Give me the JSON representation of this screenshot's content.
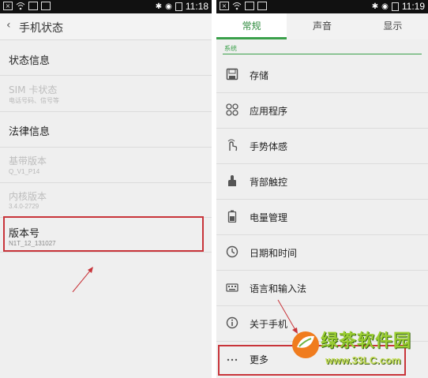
{
  "left": {
    "status_time": "11:18",
    "title": "手机状态",
    "rows": [
      {
        "title": "状态信息",
        "sub": ""
      },
      {
        "title": "SIM 卡状态",
        "sub": "电话号码、信号等"
      },
      {
        "title": "法律信息",
        "sub": ""
      },
      {
        "title": "基带版本",
        "sub": "Q_V1_P14"
      },
      {
        "title": "内核版本",
        "sub": "3.4.0-2729"
      },
      {
        "title": "版本号",
        "sub": "N1T_12_131027"
      }
    ]
  },
  "right": {
    "status_time": "11:19",
    "tabs": [
      "常规",
      "声音",
      "显示"
    ],
    "section": "系统",
    "items": [
      {
        "label": "存储",
        "icon": "storage-icon"
      },
      {
        "label": "应用程序",
        "icon": "apps-icon"
      },
      {
        "label": "手势体感",
        "icon": "gesture-icon"
      },
      {
        "label": "背部触控",
        "icon": "back-touch-icon"
      },
      {
        "label": "电量管理",
        "icon": "battery-icon"
      },
      {
        "label": "日期和时间",
        "icon": "clock-icon"
      },
      {
        "label": "语言和输入法",
        "icon": "keyboard-icon"
      },
      {
        "label": "关于手机",
        "icon": "info-icon"
      },
      {
        "label": "更多",
        "icon": "more-icon"
      }
    ]
  },
  "watermark": {
    "title": "绿茶软件园",
    "url": "www.33LC.com"
  },
  "colors": {
    "accent": "#3aa04a",
    "highlight": "#c8343a"
  }
}
